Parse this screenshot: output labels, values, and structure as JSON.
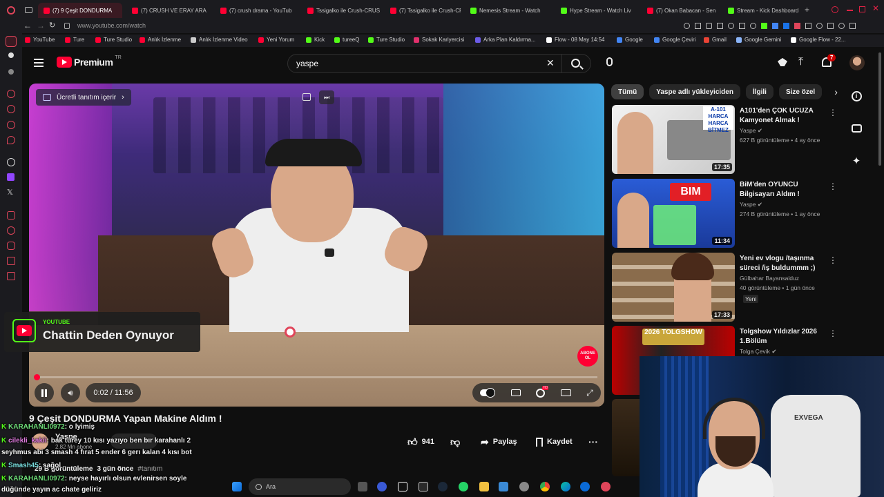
{
  "browser": {
    "tabs": [
      {
        "label": "(7) 9 Çeşit DONDURMA",
        "favicon": "youtube",
        "active": true
      },
      {
        "label": "(7) CRUSH VE ERAY ARA",
        "favicon": "youtube"
      },
      {
        "label": "(7) crush drama - YouTub",
        "favicon": "youtube"
      },
      {
        "label": "Tssigalko ile Crush-CRUS",
        "favicon": "youtube"
      },
      {
        "label": "(7) Tssigalko ile Crush-CR",
        "favicon": "youtube"
      },
      {
        "label": "Nemesis Stream - Watch",
        "favicon": "kick"
      },
      {
        "label": "Hype Stream - Watch Liv",
        "favicon": "kick"
      },
      {
        "label": "(7) Okan Babacan - Sen F",
        "favicon": "youtube"
      },
      {
        "label": "Stream - Kick Dashboard",
        "favicon": "kick"
      }
    ],
    "url": "www.youtube.com/watch",
    "bookmarks": [
      {
        "label": "YouTube",
        "color": "#ff0033"
      },
      {
        "label": "Ture",
        "color": "#ff0033"
      },
      {
        "label": "Ture Studio",
        "color": "#ff0033"
      },
      {
        "label": "Anlık İzlenme",
        "color": "#ff0033"
      },
      {
        "label": "Anlık İzlenme Video",
        "color": "#cccccc"
      },
      {
        "label": "Yeni Yorum",
        "color": "#ff0033"
      },
      {
        "label": "Kick",
        "color": "#53fc18"
      },
      {
        "label": "tureeQ",
        "color": "#53fc18"
      },
      {
        "label": "Ture Studio",
        "color": "#53fc18"
      },
      {
        "label": "Sokak Kariyercisi",
        "color": "#e1306c"
      },
      {
        "label": "Arka Plan Kaldırma...",
        "color": "#6c5ce7"
      },
      {
        "label": "Flow - 08 May 14:54",
        "color": "#ffffff"
      },
      {
        "label": "Google",
        "color": "#4285f4"
      },
      {
        "label": "Google Çeviri",
        "color": "#4285f4"
      },
      {
        "label": "Gmail",
        "color": "#ea4335"
      },
      {
        "label": "Google Gemini",
        "color": "#8ab4f8"
      },
      {
        "label": "Google Flow - 22...",
        "color": "#ffffff"
      }
    ]
  },
  "youtube": {
    "logo_text": "Premium",
    "logo_region": "TR",
    "search_value": "yaspe",
    "notification_count": "7"
  },
  "video": {
    "paid_promo_label": "Ücretli tanıtım içerir",
    "lower_third_brand": "YOUTUBE",
    "lower_third_text": "Chattin Deden Oynuyor",
    "watermark_text": "ABONE OL",
    "time_current": "0:02",
    "time_total": "11:56",
    "time_display": "0:02 / 11:56",
    "progress_fraction": 0.003,
    "title": "9 Çeşit DONDURMA Yapan Makine Aldım !",
    "channel": "Yaspe",
    "subscribers": "2,82 Mn abone",
    "views_line": "29 B görüntüleme",
    "age_line": "3 gün önce",
    "hashtag": "#tanıtım",
    "likes": "941",
    "share_label": "Paylaş",
    "save_label": "Kaydet"
  },
  "chips": [
    "Tümü",
    "Yaspe adlı yükleyiciden",
    "İlgili",
    "Size özel"
  ],
  "recommendations": [
    {
      "title": "A101'den ÇOK UCUZA Kamyonet Almak !",
      "channel": "Yaspe",
      "verified": true,
      "meta": "627 B görüntüleme • 4 ay önce",
      "duration": "17:35",
      "thumb_text": "A-101 HARCA HARCA BİTMEZ"
    },
    {
      "title": "BiM'den OYUNCU Bilgisayarı Aldım !",
      "channel": "Yaspe",
      "verified": true,
      "meta": "274 B görüntüleme • 1 ay önce",
      "duration": "11:34",
      "thumb_text": "BIM"
    },
    {
      "title": "Yeni ev vlogu /taşınma süreci /iş buldummm ;)",
      "channel": "Gülbahar Bayansalduz",
      "verified": false,
      "meta": "40 görüntüleme • 1 gün önce",
      "badge": "Yeni",
      "duration": "17:33"
    },
    {
      "title": "Tolgshow Yıldızlar 2026 1.Bölüm",
      "channel": "Tolga Çevik",
      "verified": true,
      "meta": "",
      "duration": "",
      "thumb_text": "2026 TOLGSHOW"
    }
  ],
  "chat": [
    {
      "user": "KARAHANLI0972",
      "message": ": o lyimiş"
    },
    {
      "user": "cilekli_kakii",
      "message": ": bak türey 10 kısı yazıyo ben bır karahanlı 2"
    },
    {
      "user": "",
      "message": "seyhmus abi 3 smash 4 fırat 5 ender 6 gerı kalan 4 kısı bot"
    },
    {
      "user": "Smash45",
      "message": ": sağol"
    },
    {
      "user": "KARAHANLI0972",
      "message": ": neyse hayırlı olsun evlenirsen soyle"
    },
    {
      "user": "",
      "message": "düğünde yayın ac chate geliriz"
    }
  ],
  "taskbar": {
    "search_placeholder": "Ara"
  },
  "webcam": {
    "headset_brand": "EXVEGA"
  },
  "colors": {
    "accent": "#ff0033",
    "kick": "#53fc18",
    "background": "#0f0f0f"
  }
}
